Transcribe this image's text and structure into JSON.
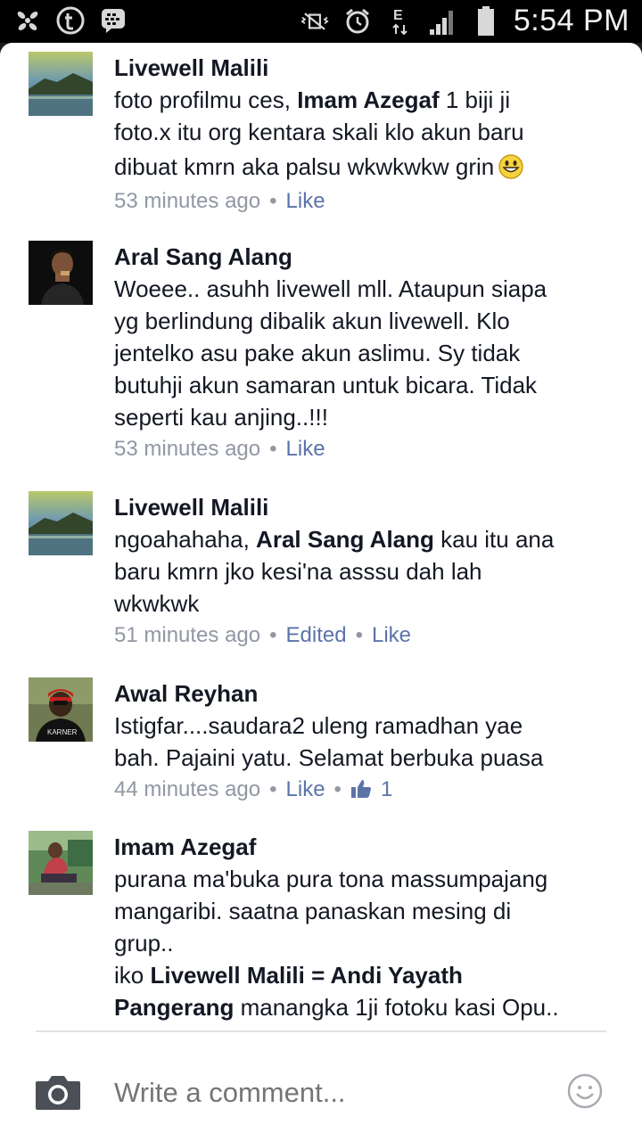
{
  "status_bar": {
    "time": "5:54 PM",
    "left_icons": [
      "pinwheel-icon",
      "tumblr-icon",
      "blackberry-messenger-icon"
    ],
    "right_icons": [
      "vibrate-mute-icon",
      "alarm-icon",
      "data-e-icon",
      "signal-icon",
      "battery-icon"
    ]
  },
  "comments": [
    {
      "name": "Livewell Malili",
      "text_parts": [
        {
          "t": "foto profilmu ces, ",
          "b": false
        },
        {
          "t": "Imam Azegaf",
          "b": true
        },
        {
          "t": " 1 biji ji foto.x itu org kentara skali klo akun baru dibuat kmrn aka palsu wkwkwkw grin",
          "b": false
        }
      ],
      "lines": [
        "foto profilmu ces, ",
        "Imam Azegaf",
        " 1 biji ji",
        "foto.x itu org kentara skali klo akun baru",
        "dibuat kmrn aka palsu wkwkwkw grin"
      ],
      "time": "53 minutes ago",
      "actions": [
        "Like"
      ],
      "avatar": "landscape"
    },
    {
      "name": "Aral Sang Alang",
      "lines": [
        "Woeee.. asuhh livewell mll. Ataupun siapa",
        "yg berlindung dibalik akun livewell. Klo",
        "jentelko asu pake akun aslimu. Sy tidak",
        "butuhji akun samaran untuk bicara. Tidak",
        "seperti kau anjing..!!!"
      ],
      "time": "53 minutes ago",
      "actions": [
        "Like"
      ],
      "avatar": "dark-person"
    },
    {
      "name": "Livewell Malili",
      "lines": [
        "ngoahahaha, ",
        "Aral Sang Alang",
        " kau itu ana",
        "baru kmrn jko kesi'na asssu dah lah",
        "wkwkwk"
      ],
      "time": "51 minutes ago",
      "actions": [
        "Edited",
        "Like"
      ],
      "avatar": "landscape"
    },
    {
      "name": "Awal Reyhan",
      "lines": [
        "Istigfar....saudara2 uleng ramadhan yae",
        "bah. Pajaini yatu. Selamat berbuka puasa"
      ],
      "time": "44 minutes ago",
      "actions": [
        "Like"
      ],
      "like_count": "1",
      "avatar": "person-cap"
    },
    {
      "name": "Imam Azegaf",
      "lines": [
        "purana ma'buka pura tona massumpajang",
        "mangaribi. saatna panaskan mesing di",
        "grup..",
        "iko ",
        "Livewell Malili = Andi Yayath",
        "Pangerang",
        " manangka 1ji fotoku kasi Opu.."
      ],
      "avatar": "person-outdoor"
    }
  ],
  "composer": {
    "placeholder": "Write a comment..."
  },
  "colors": {
    "name": "#141823",
    "meta": "#9197a3",
    "link": "#5b74a8"
  }
}
